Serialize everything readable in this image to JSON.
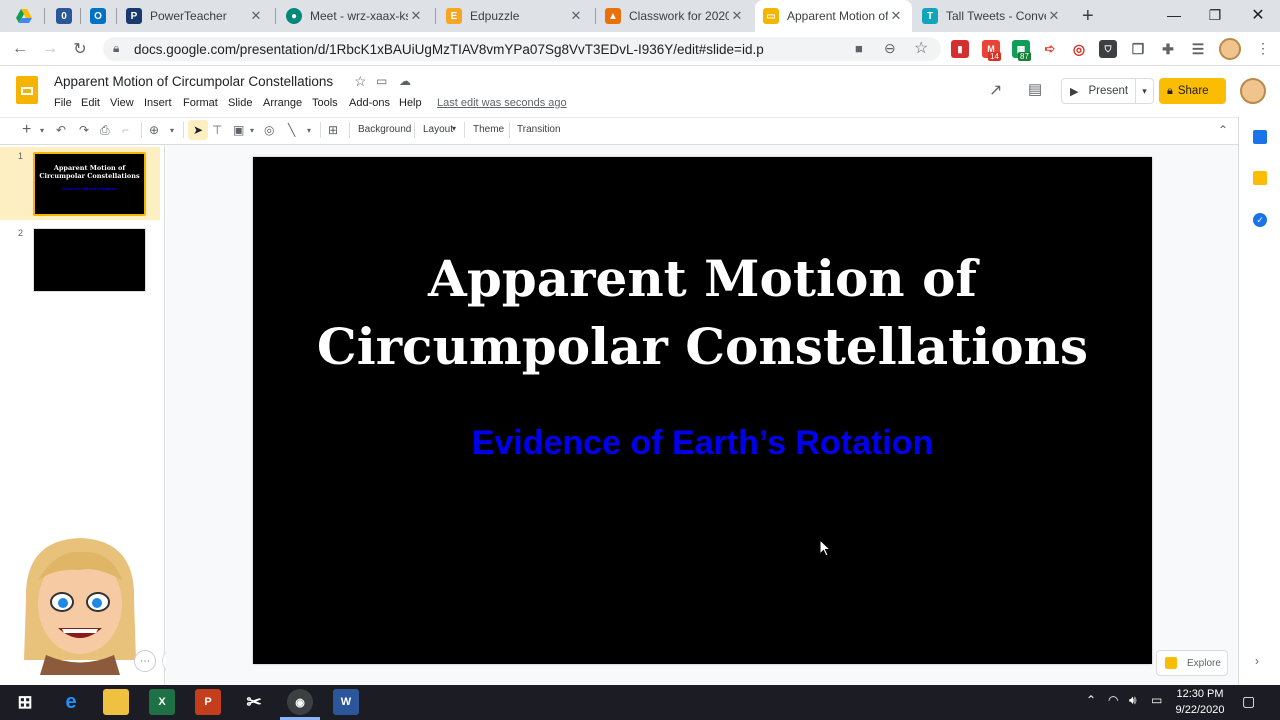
{
  "tabs": [
    {
      "title": "",
      "icon": "google-drive-icon"
    },
    {
      "title": "",
      "icon": "onenote-icon"
    },
    {
      "title": "",
      "icon": "outlook-icon"
    },
    {
      "title": "PowerTeacher",
      "icon": "powerteacher-icon"
    },
    {
      "title": "Meet - wrz-xaax-ksf",
      "icon": "google-meet-icon"
    },
    {
      "title": "Edpuzzle",
      "icon": "edpuzzle-icon"
    },
    {
      "title": "Classwork for 2020",
      "icon": "google-classroom-icon"
    },
    {
      "title": "Apparent Motion of",
      "icon": "google-slides-icon"
    },
    {
      "title": "Tall Tweets - Conver",
      "icon": "tall-tweets-icon"
    }
  ],
  "browser": {
    "url": "docs.google.com/presentation/d/1RbcK1xBAUiUgMzTIAV8vmYPa07Sg8VvT3EDvL-I936Y/edit#slide=id.p",
    "extension_badges": {
      "gmail": "14",
      "sheets": "87"
    }
  },
  "doc": {
    "title": "Apparent Motion of Circumpolar Constellations",
    "menus": [
      "File",
      "Edit",
      "View",
      "Insert",
      "Format",
      "Slide",
      "Arrange",
      "Tools",
      "Add-ons",
      "Help"
    ],
    "last_edit": "Last edit was seconds ago",
    "present_label": "Present",
    "share_label": "Share"
  },
  "toolbar": {
    "background_label": "Background",
    "layout_label": "Layout",
    "theme_label": "Theme",
    "transition_label": "Transition"
  },
  "filmstrip": {
    "slides": [
      {
        "number": "1",
        "title": "Apparent Motion of Circumpolar Constellations",
        "subtitle": "Evidence of Earth's Rotation"
      },
      {
        "number": "2"
      }
    ]
  },
  "slide": {
    "title_line1": "Apparent Motion of",
    "title_line2": "Circumpolar Constellations",
    "subtitle": "Evidence of Earth’s Rotation",
    "background": "#000000",
    "title_color": "#ffffff",
    "subtitle_color": "#0000ee"
  },
  "explore_label": "Explore",
  "taskbar": {
    "time": "12:30 PM",
    "date": "9/22/2020"
  }
}
